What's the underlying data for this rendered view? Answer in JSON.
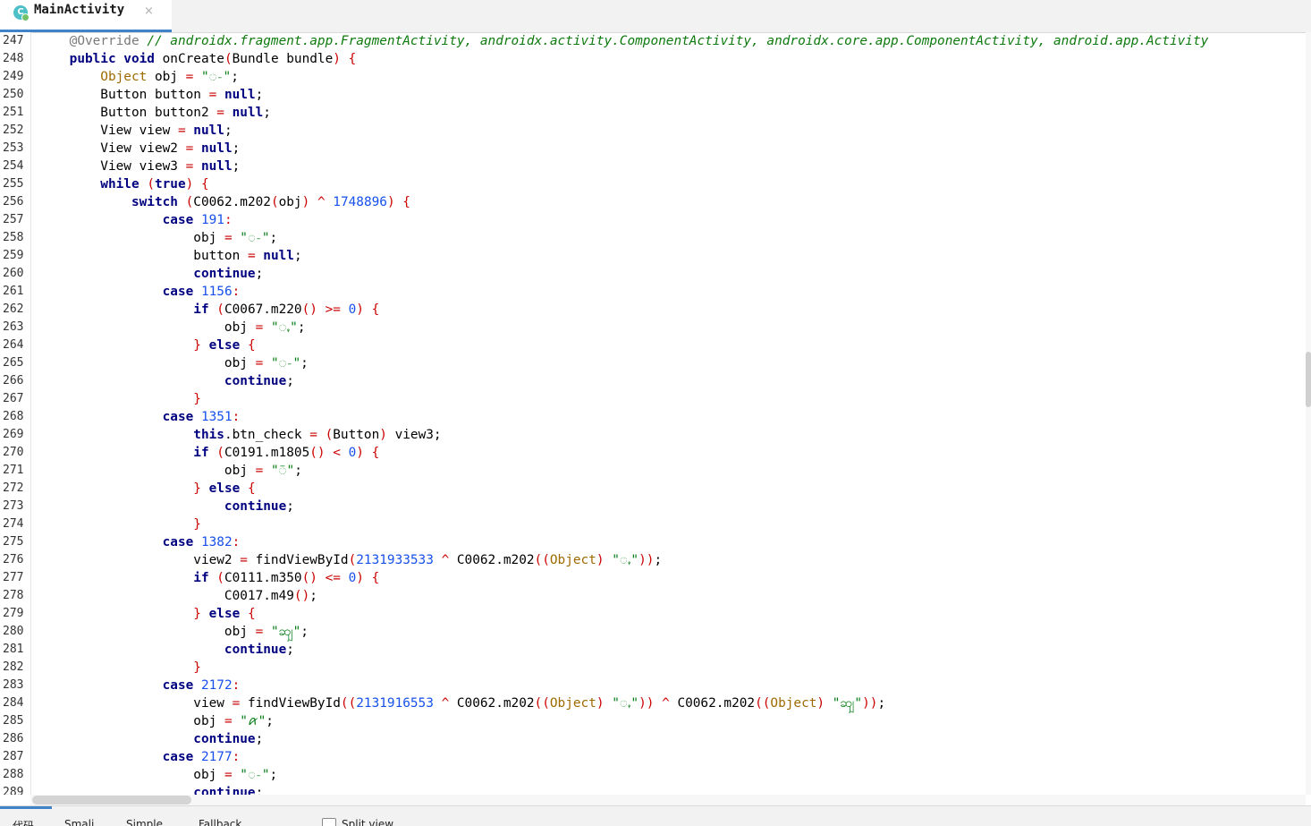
{
  "tab": {
    "title": "MainActivity",
    "close": "×",
    "icon_letter": "C"
  },
  "code": [
    {
      "n": "247",
      "t": [
        [
          "a",
          "    @Override"
        ],
        [
          "pl",
          " "
        ],
        [
          "c",
          "// androidx.fragment.app.FragmentActivity, androidx.activity.ComponentActivity, androidx.core.app.ComponentActivity, android.app.Activity"
        ]
      ]
    },
    {
      "n": "248",
      "t": [
        [
          "k",
          "    public void"
        ],
        [
          "pl",
          " onCreate"
        ],
        [
          "p",
          "("
        ],
        [
          "pl",
          "Bundle bundle"
        ],
        [
          "p",
          ")"
        ],
        [
          "pl",
          " "
        ],
        [
          "p",
          "{"
        ]
      ]
    },
    {
      "n": "249",
      "t": [
        [
          "t",
          "        Object"
        ],
        [
          "pl",
          " obj "
        ],
        [
          "p",
          "="
        ],
        [
          "pl",
          " "
        ],
        [
          "s",
          "\"ꩽ\""
        ],
        [
          "pl",
          ";"
        ]
      ]
    },
    {
      "n": "250",
      "t": [
        [
          "pl",
          "        Button button "
        ],
        [
          "p",
          "="
        ],
        [
          "pl",
          " "
        ],
        [
          "k",
          "null"
        ],
        [
          "pl",
          ";"
        ]
      ]
    },
    {
      "n": "251",
      "t": [
        [
          "pl",
          "        Button button2 "
        ],
        [
          "p",
          "="
        ],
        [
          "pl",
          " "
        ],
        [
          "k",
          "null"
        ],
        [
          "pl",
          ";"
        ]
      ]
    },
    {
      "n": "252",
      "t": [
        [
          "pl",
          "        View view "
        ],
        [
          "p",
          "="
        ],
        [
          "pl",
          " "
        ],
        [
          "k",
          "null"
        ],
        [
          "pl",
          ";"
        ]
      ]
    },
    {
      "n": "253",
      "t": [
        [
          "pl",
          "        View view2 "
        ],
        [
          "p",
          "="
        ],
        [
          "pl",
          " "
        ],
        [
          "k",
          "null"
        ],
        [
          "pl",
          ";"
        ]
      ]
    },
    {
      "n": "254",
      "t": [
        [
          "pl",
          "        View view3 "
        ],
        [
          "p",
          "="
        ],
        [
          "pl",
          " "
        ],
        [
          "k",
          "null"
        ],
        [
          "pl",
          ";"
        ]
      ]
    },
    {
      "n": "255",
      "t": [
        [
          "k",
          "        while"
        ],
        [
          "pl",
          " "
        ],
        [
          "p",
          "("
        ],
        [
          "k",
          "true"
        ],
        [
          "p",
          ")"
        ],
        [
          "pl",
          " "
        ],
        [
          "p",
          "{"
        ]
      ]
    },
    {
      "n": "256",
      "t": [
        [
          "k",
          "            switch"
        ],
        [
          "pl",
          " "
        ],
        [
          "p",
          "("
        ],
        [
          "pl",
          "C0062.m202"
        ],
        [
          "p",
          "("
        ],
        [
          "pl",
          "obj"
        ],
        [
          "p",
          ")"
        ],
        [
          "pl",
          " "
        ],
        [
          "p",
          "^"
        ],
        [
          "pl",
          " "
        ],
        [
          "n",
          "1748896"
        ],
        [
          "p",
          ")"
        ],
        [
          "pl",
          " "
        ],
        [
          "p",
          "{"
        ]
      ]
    },
    {
      "n": "257",
      "t": [
        [
          "k",
          "                case"
        ],
        [
          "pl",
          " "
        ],
        [
          "n",
          "191"
        ],
        [
          "p",
          ":"
        ]
      ]
    },
    {
      "n": "258",
      "t": [
        [
          "pl",
          "                    obj "
        ],
        [
          "p",
          "="
        ],
        [
          "pl",
          " "
        ],
        [
          "s",
          "\"ꩽ\""
        ],
        [
          "pl",
          ";"
        ]
      ]
    },
    {
      "n": "259",
      "t": [
        [
          "pl",
          "                    button "
        ],
        [
          "p",
          "="
        ],
        [
          "pl",
          " "
        ],
        [
          "k",
          "null"
        ],
        [
          "pl",
          ";"
        ]
      ]
    },
    {
      "n": "260",
      "t": [
        [
          "k",
          "                    continue"
        ],
        [
          "pl",
          ";"
        ]
      ]
    },
    {
      "n": "261",
      "t": [
        [
          "k",
          "                case"
        ],
        [
          "pl",
          " "
        ],
        [
          "n",
          "1156"
        ],
        [
          "p",
          ":"
        ]
      ]
    },
    {
      "n": "262",
      "t": [
        [
          "k",
          "                    if"
        ],
        [
          "pl",
          " "
        ],
        [
          "p",
          "("
        ],
        [
          "pl",
          "C0067.m220"
        ],
        [
          "p",
          "()"
        ],
        [
          "pl",
          " "
        ],
        [
          "p",
          ">="
        ],
        [
          "pl",
          " "
        ],
        [
          "n",
          "0"
        ],
        [
          "p",
          ")"
        ],
        [
          "pl",
          " "
        ],
        [
          "p",
          "{"
        ]
      ]
    },
    {
      "n": "263",
      "t": [
        [
          "pl",
          "                        obj "
        ],
        [
          "p",
          "="
        ],
        [
          "pl",
          " "
        ],
        [
          "s",
          "\"ꩻ\""
        ],
        [
          "pl",
          ";"
        ]
      ]
    },
    {
      "n": "264",
      "t": [
        [
          "p",
          "                    }"
        ],
        [
          "pl",
          " "
        ],
        [
          "k",
          "else"
        ],
        [
          "pl",
          " "
        ],
        [
          "p",
          "{"
        ]
      ]
    },
    {
      "n": "265",
      "t": [
        [
          "pl",
          "                        obj "
        ],
        [
          "p",
          "="
        ],
        [
          "pl",
          " "
        ],
        [
          "s",
          "\"ꩽ\""
        ],
        [
          "pl",
          ";"
        ]
      ]
    },
    {
      "n": "266",
      "t": [
        [
          "k",
          "                        continue"
        ],
        [
          "pl",
          ";"
        ]
      ]
    },
    {
      "n": "267",
      "t": [
        [
          "p",
          "                    }"
        ]
      ]
    },
    {
      "n": "268",
      "t": [
        [
          "k",
          "                case"
        ],
        [
          "pl",
          " "
        ],
        [
          "n",
          "1351"
        ],
        [
          "p",
          ":"
        ]
      ]
    },
    {
      "n": "269",
      "t": [
        [
          "k",
          "                    this"
        ],
        [
          "pl",
          ".btn_check "
        ],
        [
          "p",
          "="
        ],
        [
          "pl",
          " "
        ],
        [
          "p",
          "("
        ],
        [
          "pl",
          "Button"
        ],
        [
          "p",
          ")"
        ],
        [
          "pl",
          " view3;"
        ]
      ]
    },
    {
      "n": "270",
      "t": [
        [
          "k",
          "                    if"
        ],
        [
          "pl",
          " "
        ],
        [
          "p",
          "("
        ],
        [
          "pl",
          "C0191.m1805"
        ],
        [
          "p",
          "()"
        ],
        [
          "pl",
          " "
        ],
        [
          "p",
          "<"
        ],
        [
          "pl",
          " "
        ],
        [
          "n",
          "0"
        ],
        [
          "p",
          ")"
        ],
        [
          "pl",
          " "
        ],
        [
          "p",
          "{"
        ]
      ]
    },
    {
      "n": "271",
      "t": [
        [
          "pl",
          "                        obj "
        ],
        [
          "p",
          "="
        ],
        [
          "pl",
          " "
        ],
        [
          "s",
          "\"ꩼ\""
        ],
        [
          "pl",
          ";"
        ]
      ]
    },
    {
      "n": "272",
      "t": [
        [
          "p",
          "                    }"
        ],
        [
          "pl",
          " "
        ],
        [
          "k",
          "else"
        ],
        [
          "pl",
          " "
        ],
        [
          "p",
          "{"
        ]
      ]
    },
    {
      "n": "273",
      "t": [
        [
          "k",
          "                        continue"
        ],
        [
          "pl",
          ";"
        ]
      ]
    },
    {
      "n": "274",
      "t": [
        [
          "p",
          "                    }"
        ]
      ]
    },
    {
      "n": "275",
      "t": [
        [
          "k",
          "                case"
        ],
        [
          "pl",
          " "
        ],
        [
          "n",
          "1382"
        ],
        [
          "p",
          ":"
        ]
      ]
    },
    {
      "n": "276",
      "t": [
        [
          "pl",
          "                    view2 "
        ],
        [
          "p",
          "="
        ],
        [
          "pl",
          " findViewById"
        ],
        [
          "p",
          "("
        ],
        [
          "n",
          "2131933533"
        ],
        [
          "pl",
          " "
        ],
        [
          "p",
          "^"
        ],
        [
          "pl",
          " C0062.m202"
        ],
        [
          "p",
          "(("
        ],
        [
          "t",
          "Object"
        ],
        [
          "p",
          ")"
        ],
        [
          "pl",
          " "
        ],
        [
          "s",
          "\"ꩻ\""
        ],
        [
          "p",
          "))"
        ],
        [
          "pl",
          ";"
        ]
      ]
    },
    {
      "n": "277",
      "t": [
        [
          "k",
          "                    if"
        ],
        [
          "pl",
          " "
        ],
        [
          "p",
          "("
        ],
        [
          "pl",
          "C0111.m350"
        ],
        [
          "p",
          "()"
        ],
        [
          "pl",
          " "
        ],
        [
          "p",
          "<="
        ],
        [
          "pl",
          " "
        ],
        [
          "n",
          "0"
        ],
        [
          "p",
          ")"
        ],
        [
          "pl",
          " "
        ],
        [
          "p",
          "{"
        ]
      ]
    },
    {
      "n": "278",
      "t": [
        [
          "pl",
          "                        C0017.m49"
        ],
        [
          "p",
          "()"
        ],
        [
          "pl",
          ";"
        ]
      ]
    },
    {
      "n": "279",
      "t": [
        [
          "p",
          "                    }"
        ],
        [
          "pl",
          " "
        ],
        [
          "k",
          "else"
        ],
        [
          "pl",
          " "
        ],
        [
          "p",
          "{"
        ]
      ]
    },
    {
      "n": "280",
      "t": [
        [
          "pl",
          "                        obj "
        ],
        [
          "p",
          "="
        ],
        [
          "pl",
          " "
        ],
        [
          "s",
          "\"ꩿ\""
        ],
        [
          "pl",
          ";"
        ]
      ]
    },
    {
      "n": "281",
      "t": [
        [
          "k",
          "                        continue"
        ],
        [
          "pl",
          ";"
        ]
      ]
    },
    {
      "n": "282",
      "t": [
        [
          "p",
          "                    }"
        ]
      ]
    },
    {
      "n": "283",
      "t": [
        [
          "k",
          "                case"
        ],
        [
          "pl",
          " "
        ],
        [
          "n",
          "2172"
        ],
        [
          "p",
          ":"
        ]
      ]
    },
    {
      "n": "284",
      "t": [
        [
          "pl",
          "                    view "
        ],
        [
          "p",
          "="
        ],
        [
          "pl",
          " findViewById"
        ],
        [
          "p",
          "(("
        ],
        [
          "n",
          "2131916553"
        ],
        [
          "pl",
          " "
        ],
        [
          "p",
          "^"
        ],
        [
          "pl",
          " C0062.m202"
        ],
        [
          "p",
          "(("
        ],
        [
          "t",
          "Object"
        ],
        [
          "p",
          ")"
        ],
        [
          "pl",
          " "
        ],
        [
          "s",
          "\"ꩻ\""
        ],
        [
          "p",
          "))"
        ],
        [
          "pl",
          " "
        ],
        [
          "p",
          "^"
        ],
        [
          "pl",
          " C0062.m202"
        ],
        [
          "p",
          "(("
        ],
        [
          "t",
          "Object"
        ],
        [
          "p",
          ")"
        ],
        [
          "pl",
          " "
        ],
        [
          "s",
          "\"ꩿ\""
        ],
        [
          "p",
          "))"
        ],
        [
          "pl",
          ";"
        ]
      ]
    },
    {
      "n": "285",
      "t": [
        [
          "pl",
          "                    obj "
        ],
        [
          "p",
          "="
        ],
        [
          "pl",
          " "
        ],
        [
          "s",
          "\"ꪁ\""
        ],
        [
          "pl",
          ";"
        ]
      ]
    },
    {
      "n": "286",
      "t": [
        [
          "k",
          "                    continue"
        ],
        [
          "pl",
          ";"
        ]
      ]
    },
    {
      "n": "287",
      "t": [
        [
          "k",
          "                case"
        ],
        [
          "pl",
          " "
        ],
        [
          "n",
          "2177"
        ],
        [
          "p",
          ":"
        ]
      ]
    },
    {
      "n": "288",
      "t": [
        [
          "pl",
          "                    obj "
        ],
        [
          "p",
          "="
        ],
        [
          "pl",
          " "
        ],
        [
          "s",
          "\"ꩽ\""
        ],
        [
          "pl",
          ";"
        ]
      ]
    },
    {
      "n": "289",
      "t": [
        [
          "k",
          "                    continue"
        ],
        [
          "pl",
          ";"
        ]
      ]
    }
  ],
  "bottom": {
    "tabs": [
      "代码",
      "Smali",
      "Simple",
      "Fallback"
    ],
    "split_view": "Split view"
  }
}
